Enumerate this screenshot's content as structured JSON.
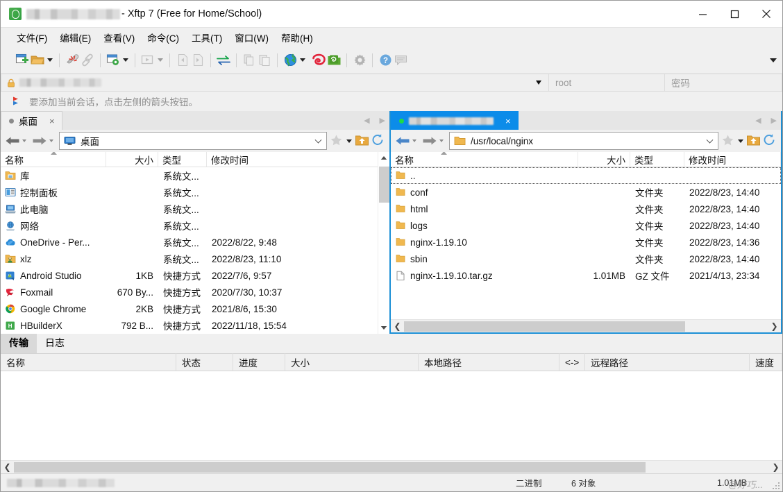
{
  "window": {
    "title_suffix": "- Xftp 7 (Free for Home/School)",
    "title_redacted": true,
    "controls": {
      "minimize": "minimize-button",
      "maximize": "maximize-button",
      "close": "close-button"
    }
  },
  "menubar": {
    "items": [
      {
        "label": "文件(F)",
        "name": "menu-file"
      },
      {
        "label": "编辑(E)",
        "name": "menu-edit"
      },
      {
        "label": "查看(V)",
        "name": "menu-view"
      },
      {
        "label": "命令(C)",
        "name": "menu-command"
      },
      {
        "label": "工具(T)",
        "name": "menu-tools"
      },
      {
        "label": "窗口(W)",
        "name": "menu-window"
      },
      {
        "label": "帮助(H)",
        "name": "menu-help"
      }
    ]
  },
  "toolbar": {
    "items": [
      "new-session-icon",
      "open-folder-icon",
      "disconnect-icon",
      "link-icon",
      "session-properties-icon",
      "run-icon",
      "transfer-left-icon",
      "transfer-right-icon",
      "sync-icon",
      "copy-icon",
      "paste-icon",
      "globe-icon",
      "xshell-icon",
      "xftp-icon",
      "settings-gear-icon",
      "help-icon",
      "feedback-icon"
    ],
    "overflow": "toolbar-overflow-icon"
  },
  "sessionbar": {
    "host_redacted": true,
    "host_placeholder": "",
    "username_value": "root",
    "password_placeholder": "密码"
  },
  "hint": {
    "text": "要添加当前会话，点击左侧的箭头按钮。"
  },
  "left_panel": {
    "tab": {
      "label": "桌面",
      "close": "×",
      "status_color": "#8a8a8a"
    },
    "path": "桌面",
    "columns": [
      "名称",
      "大小",
      "类型",
      "修改时间"
    ],
    "sort_column": "名称",
    "rows": [
      {
        "name": "库",
        "size": "",
        "type": "系统文...",
        "modified": "",
        "icon": "library-folder-icon"
      },
      {
        "name": "控制面板",
        "size": "",
        "type": "系统文...",
        "modified": "",
        "icon": "control-panel-icon"
      },
      {
        "name": "此电脑",
        "size": "",
        "type": "系统文...",
        "modified": "",
        "icon": "this-pc-icon"
      },
      {
        "name": "网络",
        "size": "",
        "type": "系统文...",
        "modified": "",
        "icon": "network-icon"
      },
      {
        "name": "OneDrive - Per...",
        "size": "",
        "type": "系统文...",
        "modified": "2022/8/22, 9:48",
        "icon": "onedrive-icon"
      },
      {
        "name": "xlz",
        "size": "",
        "type": "系统文...",
        "modified": "2022/8/23, 11:10",
        "icon": "user-folder-icon"
      },
      {
        "name": "Android Studio",
        "size": "1KB",
        "type": "快捷方式",
        "modified": "2022/7/6, 9:57",
        "icon": "android-studio-icon"
      },
      {
        "name": "Foxmail",
        "size": "670 By...",
        "type": "快捷方式",
        "modified": "2020/7/30, 10:37",
        "icon": "foxmail-icon"
      },
      {
        "name": "Google Chrome",
        "size": "2KB",
        "type": "快捷方式",
        "modified": "2021/8/6, 15:30",
        "icon": "chrome-icon"
      },
      {
        "name": "HBuilderX",
        "size": "792 B...",
        "type": "快捷方式",
        "modified": "2022/11/18, 15:54",
        "icon": "hbuilderx-icon"
      }
    ]
  },
  "right_panel": {
    "tab": {
      "label_redacted": true,
      "close": "×",
      "status_color": "#1ddc46"
    },
    "path": "/usr/local/nginx",
    "columns": [
      "名称",
      "大小",
      "类型",
      "修改时间"
    ],
    "sort_column": "名称",
    "rows": [
      {
        "name": "..",
        "size": "",
        "type": "",
        "modified": "",
        "icon": "parent-folder-icon",
        "selected": true
      },
      {
        "name": "conf",
        "size": "",
        "type": "文件夹",
        "modified": "2022/8/23, 14:40",
        "icon": "folder-icon"
      },
      {
        "name": "html",
        "size": "",
        "type": "文件夹",
        "modified": "2022/8/23, 14:40",
        "icon": "folder-icon"
      },
      {
        "name": "logs",
        "size": "",
        "type": "文件夹",
        "modified": "2022/8/23, 14:40",
        "icon": "folder-icon"
      },
      {
        "name": "nginx-1.19.10",
        "size": "",
        "type": "文件夹",
        "modified": "2022/8/23, 14:36",
        "icon": "folder-icon"
      },
      {
        "name": "sbin",
        "size": "",
        "type": "文件夹",
        "modified": "2022/8/23, 14:40",
        "icon": "folder-icon"
      },
      {
        "name": "nginx-1.19.10.tar.gz",
        "size": "1.01MB",
        "type": "GZ 文件",
        "modified": "2021/4/13, 23:34",
        "icon": "gz-file-icon"
      }
    ]
  },
  "transfer": {
    "tabs": [
      {
        "label": "传输",
        "active": true,
        "name": "tab-transfer"
      },
      {
        "label": "日志",
        "active": false,
        "name": "tab-log"
      }
    ],
    "columns": [
      "名称",
      "状态",
      "进度",
      "大小",
      "本地路径",
      "<->",
      "远程路径",
      "速度"
    ],
    "rows": []
  },
  "statusbar": {
    "left_redacted": true,
    "mode": "二进制",
    "objects": "6 对象",
    "total_size": "1.01MB",
    "watermark": "@好巧..."
  },
  "colors": {
    "accent": "#0c8ce9",
    "focus_border": "#1b8fd6",
    "chrome_bg": "#f0f0f0",
    "list_bg": "#ffffff",
    "folder_yellow": "#f5c24a"
  }
}
